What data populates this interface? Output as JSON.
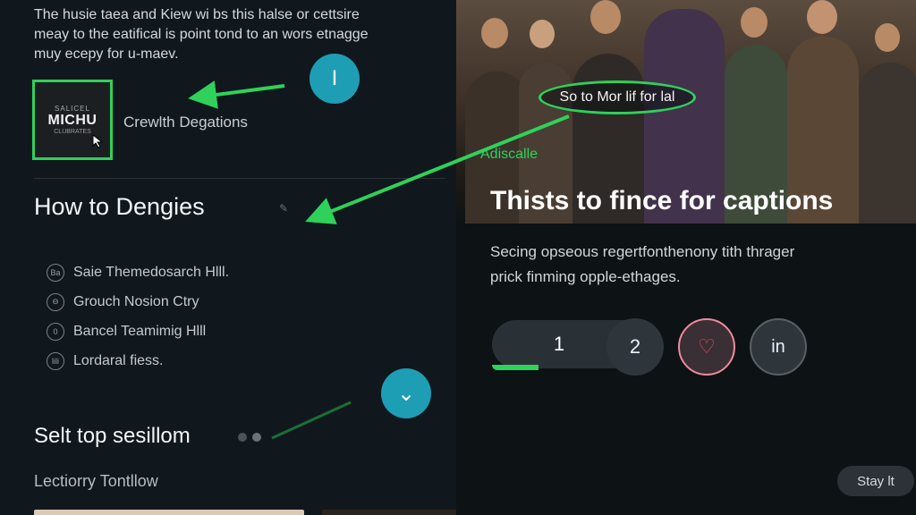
{
  "intro": {
    "line1": "The husie taea and Kiew wi bs this halse or cettsire",
    "line2": "meay to the eatifical is point tond to an wors etnagge",
    "line3": "muy ecepy for u-maev."
  },
  "thumbnail": {
    "logo_top": "SALICEL",
    "logo_main": "MICHU",
    "logo_sub": "CLUBRATES",
    "label": "Crewlth Degations"
  },
  "section": {
    "title": "How to Dengies",
    "options": [
      {
        "icon": "Ba",
        "label": "Saie Themedosarch Hlll."
      },
      {
        "icon": "⊖",
        "label": "Grouch Nosion Ctry"
      },
      {
        "icon": "0",
        "label": "Bancel Teamimig Hlll"
      },
      {
        "icon": "lili",
        "label": "Lordaral fiess."
      }
    ]
  },
  "bottom": {
    "title": "Selt top sesillom",
    "subrow": "Lectiorry Tontllow"
  },
  "buttons": {
    "teal_top": "I",
    "teal_bottom": "⌄"
  },
  "hero": {
    "overlay_chip": "So to Mor lif for lal",
    "tag": "Adiscalle",
    "title": "Thists to fince for captions",
    "desc_line1": "Secing opseous regertfonthenony tith thrager",
    "desc_line2": "prick finming opple-ethages."
  },
  "controls": {
    "pill_value": "1",
    "round2": "2",
    "round3": "♡",
    "round4": "in"
  },
  "stay_button": "Stay lt",
  "colors": {
    "accent_green": "#2fd15a",
    "teal": "#1e9eb5",
    "background": "#11181d"
  }
}
